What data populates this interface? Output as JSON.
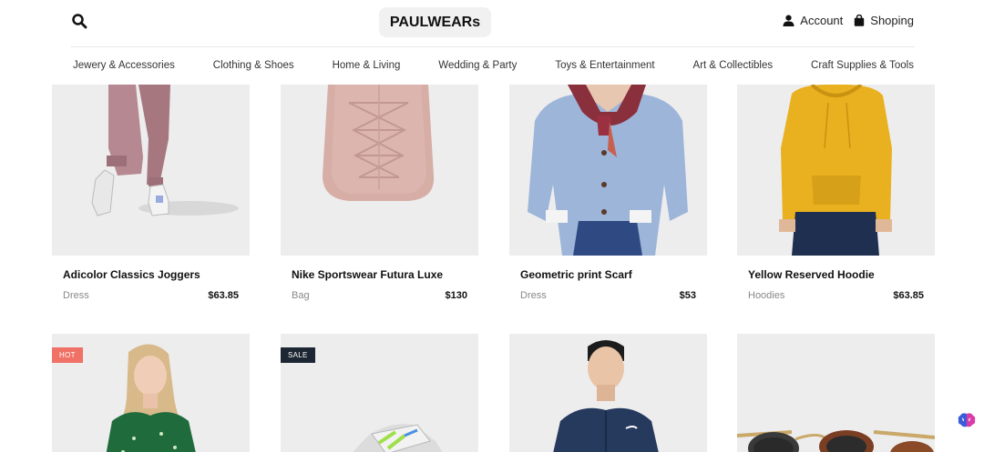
{
  "header": {
    "brand": "PAULWEARs",
    "account_label": "Account",
    "shopping_label": "Shoping",
    "icons": {
      "search": "search-icon",
      "account": "user-icon",
      "shopping": "shopping-bag-icon"
    }
  },
  "nav": {
    "categories": [
      "Jewery & Accessories",
      "Clothing & Shoes",
      "Home & Living",
      "Wedding & Party",
      "Toys & Entertainment",
      "Art & Collectibles",
      "Craft Supplies & Tools"
    ]
  },
  "products": [
    {
      "name": "Adicolor Classics Joggers",
      "category": "Dress",
      "price": "$63.85"
    },
    {
      "name": "Nike Sportswear Futura Luxe",
      "category": "Bag",
      "price": "$130"
    },
    {
      "name": "Geometric print Scarf",
      "category": "Dress",
      "price": "$53"
    },
    {
      "name": "Yellow Reserved Hoodie",
      "category": "Hoodies",
      "price": "$63.85"
    }
  ],
  "products_row2": [
    {
      "badge": "HOT"
    },
    {
      "badge": "SALE"
    },
    {},
    {}
  ],
  "colors": {
    "hot": "#f07166",
    "sale": "#1d2733",
    "card_bg": "#ededee"
  }
}
